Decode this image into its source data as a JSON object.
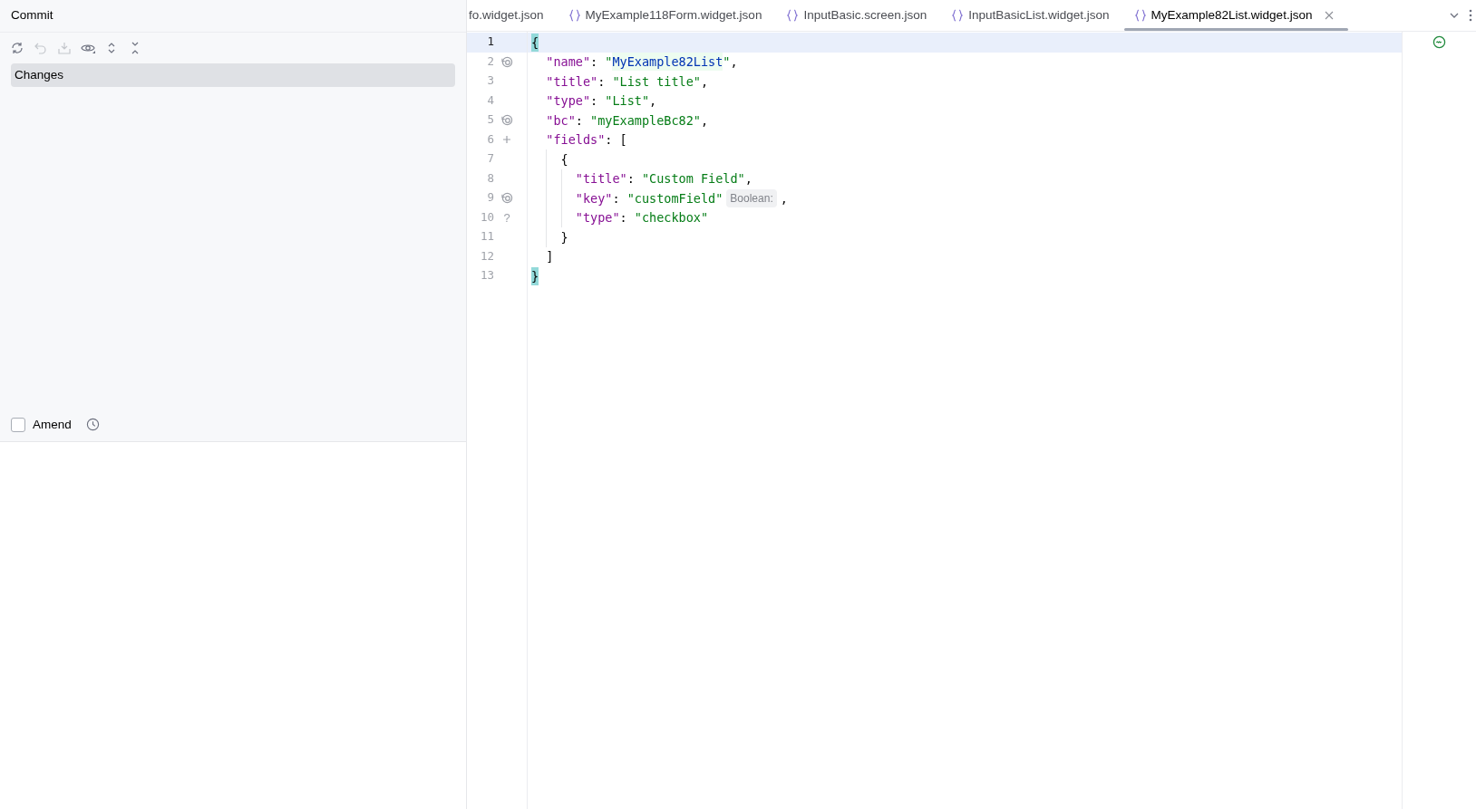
{
  "commit_panel": {
    "title": "Commit",
    "toolbar": [
      {
        "kind": "refresh",
        "disabled": false
      },
      {
        "kind": "rollback",
        "disabled": true
      },
      {
        "kind": "shelve",
        "disabled": true
      },
      {
        "kind": "eye",
        "disabled": false
      },
      {
        "kind": "expand",
        "disabled": false
      },
      {
        "kind": "collapse",
        "disabled": false
      }
    ],
    "changes": [
      {
        "label": "Changes",
        "selected": true
      }
    ],
    "amend": {
      "label": "Amend",
      "checked": false
    }
  },
  "tabs": [
    {
      "label": "fo.widget.json",
      "kind": "cut",
      "selected": false
    },
    {
      "label": "MyExample118Form.widget.json",
      "kind": "file",
      "selected": false
    },
    {
      "label": "InputBasic.screen.json",
      "kind": "file",
      "selected": false
    },
    {
      "label": "InputBasicList.widget.json",
      "kind": "file",
      "selected": false
    },
    {
      "label": "MyExample82List.widget.json",
      "kind": "file",
      "selected": true
    }
  ],
  "editor": {
    "lines": [
      {
        "number": "1",
        "current": true,
        "kind": "plain",
        "tokens": [
          {
            "kind": "brace-match",
            "text": "{"
          }
        ]
      },
      {
        "number": "2",
        "current": false,
        "kind": "web",
        "tokens": [
          {
            "kind": "key",
            "text": "  \"name\""
          },
          {
            "kind": "punct",
            "text": ": "
          },
          {
            "kind": "string",
            "text": "\""
          },
          {
            "kind": "string-match",
            "text": "MyExample82List"
          },
          {
            "kind": "string",
            "text": "\""
          },
          {
            "kind": "punct",
            "text": ","
          }
        ]
      },
      {
        "number": "3",
        "current": false,
        "kind": "plain",
        "tokens": [
          {
            "kind": "key",
            "text": "  \"title\""
          },
          {
            "kind": "punct",
            "text": ": "
          },
          {
            "kind": "string",
            "text": "\"List title\""
          },
          {
            "kind": "punct",
            "text": ","
          }
        ]
      },
      {
        "number": "4",
        "current": false,
        "kind": "plain",
        "tokens": [
          {
            "kind": "key",
            "text": "  \"type\""
          },
          {
            "kind": "punct",
            "text": ": "
          },
          {
            "kind": "string",
            "text": "\"List\""
          },
          {
            "kind": "punct",
            "text": ","
          }
        ]
      },
      {
        "number": "5",
        "current": false,
        "kind": "web",
        "tokens": [
          {
            "kind": "key",
            "text": "  \"bc\""
          },
          {
            "kind": "punct",
            "text": ": "
          },
          {
            "kind": "string",
            "text": "\"myExampleBc82\""
          },
          {
            "kind": "punct",
            "text": ","
          }
        ]
      },
      {
        "number": "6",
        "current": false,
        "kind": "plus",
        "tokens": [
          {
            "kind": "key",
            "text": "  \"fields\""
          },
          {
            "kind": "punct",
            "text": ": ["
          }
        ]
      },
      {
        "number": "7",
        "current": false,
        "kind": "plain",
        "tokens": [
          {
            "kind": "punct",
            "text": "    {"
          }
        ]
      },
      {
        "number": "8",
        "current": false,
        "kind": "plain",
        "tokens": [
          {
            "kind": "key",
            "text": "      \"title\""
          },
          {
            "kind": "punct",
            "text": ": "
          },
          {
            "kind": "string",
            "text": "\"Custom Field\""
          },
          {
            "kind": "punct",
            "text": ","
          }
        ]
      },
      {
        "number": "9",
        "current": false,
        "kind": "web",
        "tokens": [
          {
            "kind": "key",
            "text": "      \"key\""
          },
          {
            "kind": "punct",
            "text": ": "
          },
          {
            "kind": "string",
            "text": "\"customField\""
          },
          {
            "kind": "hint",
            "text": "Boolean:"
          },
          {
            "kind": "punct",
            "text": ","
          }
        ]
      },
      {
        "number": "10",
        "current": false,
        "kind": "mark",
        "marker_text": "?",
        "tokens": [
          {
            "kind": "key",
            "text": "      \"type\""
          },
          {
            "kind": "punct",
            "text": ": "
          },
          {
            "kind": "string",
            "text": "\"checkbox\""
          }
        ]
      },
      {
        "number": "11",
        "current": false,
        "kind": "plain",
        "tokens": [
          {
            "kind": "punct",
            "text": "    }"
          }
        ]
      },
      {
        "number": "12",
        "current": false,
        "kind": "plain",
        "tokens": [
          {
            "kind": "punct",
            "text": "  ]"
          }
        ]
      },
      {
        "number": "13",
        "current": false,
        "kind": "plain",
        "tokens": [
          {
            "kind": "brace-match",
            "text": "}"
          }
        ]
      }
    ]
  }
}
